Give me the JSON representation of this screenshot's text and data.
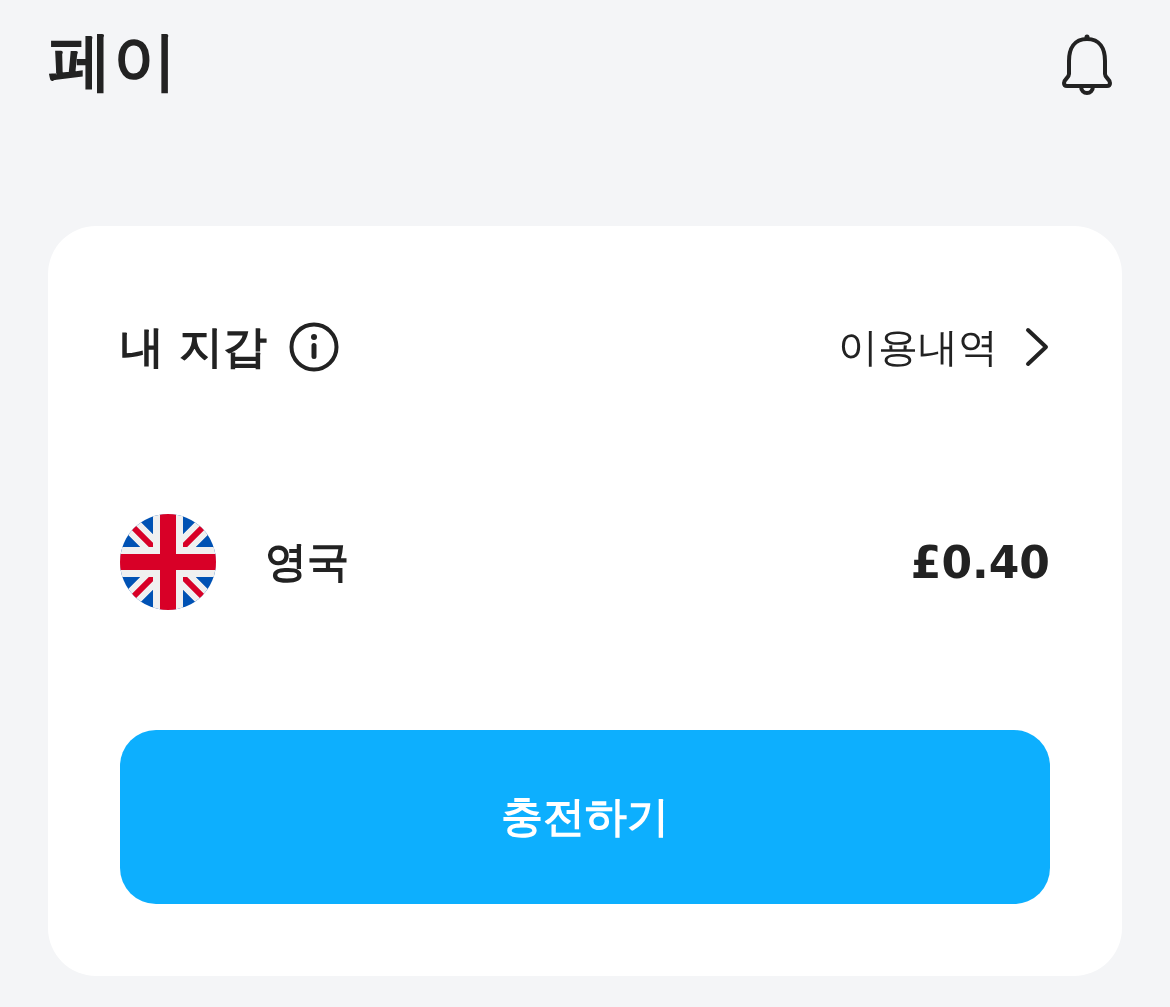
{
  "header": {
    "title": "페이"
  },
  "wallet": {
    "title": "내 지갑",
    "history_link": "이용내역",
    "balances": [
      {
        "country": "영국",
        "amount": "£0.40"
      }
    ],
    "charge_button": "충전하기"
  }
}
